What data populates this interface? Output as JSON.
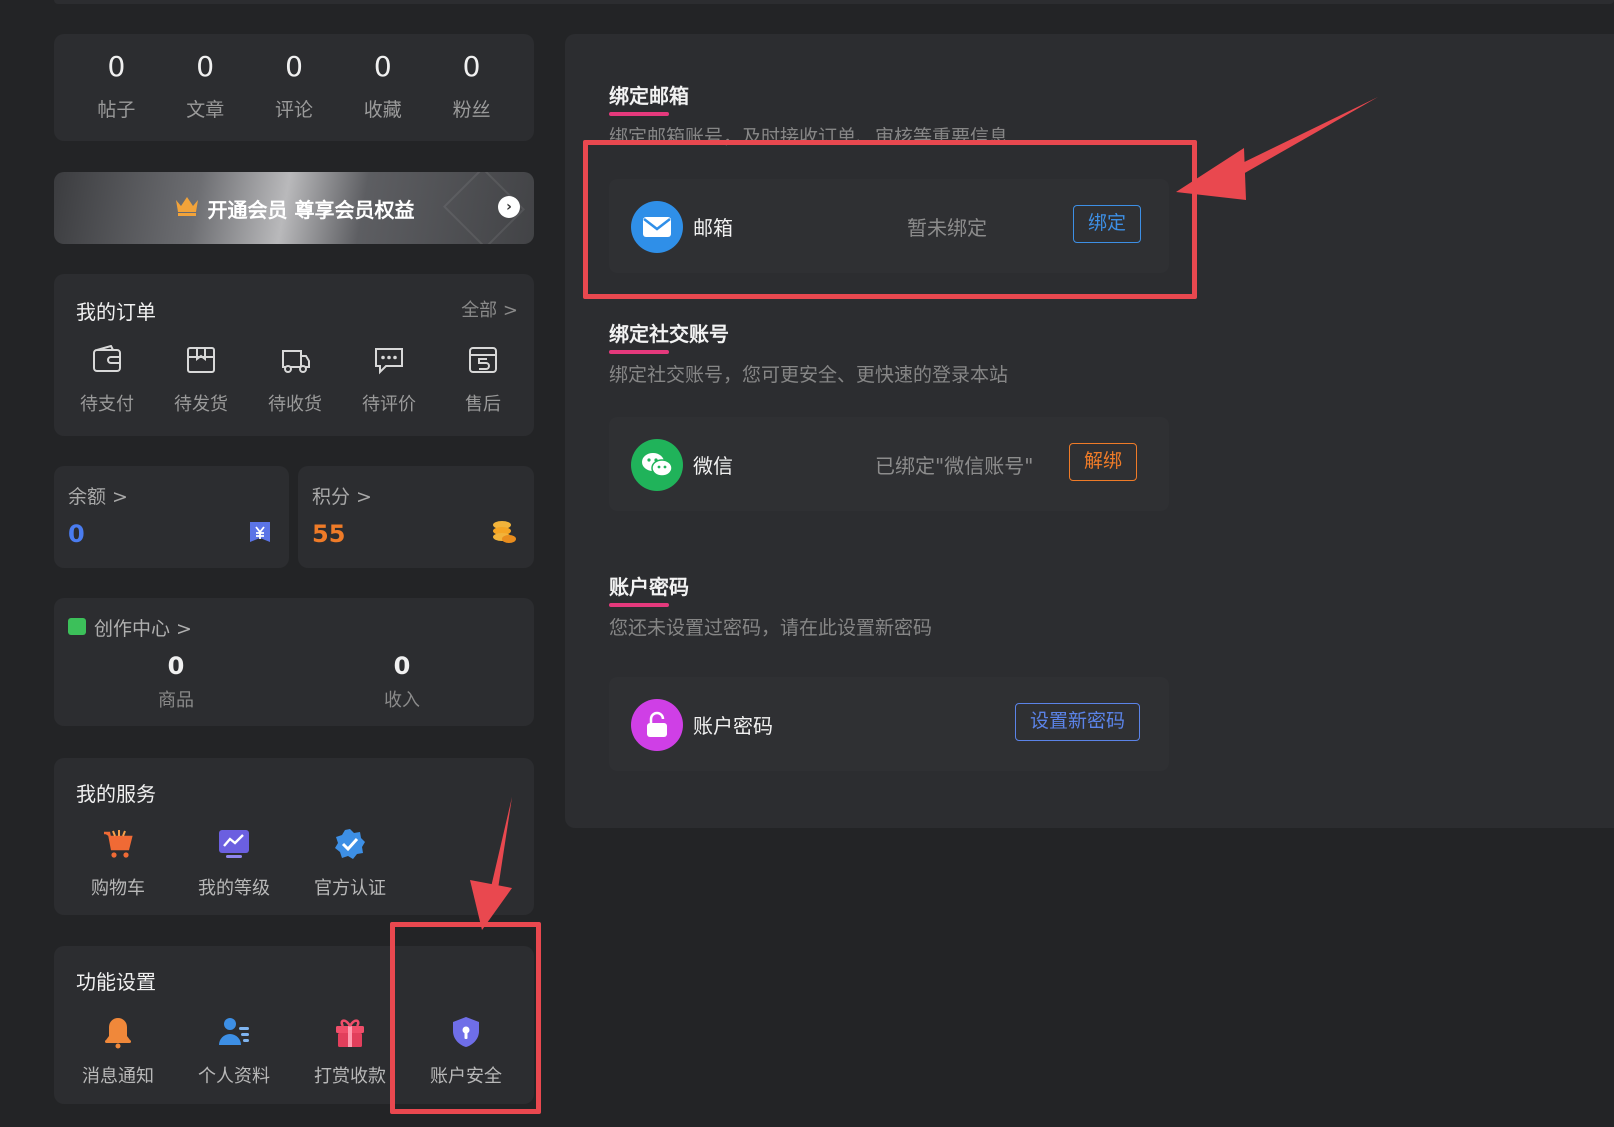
{
  "stats": [
    {
      "value": "0",
      "label": "帖子"
    },
    {
      "value": "0",
      "label": "文章"
    },
    {
      "value": "0",
      "label": "评论"
    },
    {
      "value": "0",
      "label": "收藏"
    },
    {
      "value": "0",
      "label": "粉丝"
    }
  ],
  "vip": {
    "text": "开通会员 尊享会员权益",
    "icon": "crown-icon"
  },
  "orders": {
    "title": "我的订单",
    "more": "全部 >",
    "items": [
      {
        "label": "待支付",
        "icon": "wallet-icon"
      },
      {
        "label": "待发货",
        "icon": "package-icon"
      },
      {
        "label": "待收货",
        "icon": "truck-icon"
      },
      {
        "label": "待评价",
        "icon": "comment-icon"
      },
      {
        "label": "售后",
        "icon": "refund-icon"
      }
    ]
  },
  "balance": {
    "title": "余额 >",
    "value": "0",
    "icon": "yuan-icon"
  },
  "points": {
    "title": "积分 >",
    "value": "55",
    "icon": "coins-icon"
  },
  "create_center": {
    "title": "创作中心 >",
    "items": [
      {
        "value": "0",
        "label": "商品"
      },
      {
        "value": "0",
        "label": "收入"
      }
    ]
  },
  "services": {
    "title": "我的服务",
    "items": [
      {
        "label": "购物车",
        "icon": "cart-icon"
      },
      {
        "label": "我的等级",
        "icon": "level-icon"
      },
      {
        "label": "官方认证",
        "icon": "verified-icon"
      }
    ]
  },
  "settings": {
    "title": "功能设置",
    "items": [
      {
        "label": "消息通知",
        "icon": "bell-icon"
      },
      {
        "label": "个人资料",
        "icon": "profile-icon"
      },
      {
        "label": "打赏收款",
        "icon": "gift-icon"
      },
      {
        "label": "账户安全",
        "icon": "shield-icon"
      }
    ]
  },
  "security": {
    "email_section": {
      "title": "绑定邮箱",
      "desc": "绑定邮箱账号，及时接收订单、审核等重要信息",
      "name": "邮箱",
      "status": "暂未绑定",
      "button": "绑定"
    },
    "social_section": {
      "title": "绑定社交账号",
      "desc": "绑定社交账号，您可更安全、更快速的登录本站",
      "name": "微信",
      "status": "已绑定\"微信账号\"",
      "button": "解绑"
    },
    "password_section": {
      "title": "账户密码",
      "desc": "您还未设置过密码，请在此设置新密码",
      "name": "账户密码",
      "button": "设置新密码"
    }
  },
  "colors": {
    "accent_pink": "#e5397c",
    "annotation_red": "#e9484f",
    "points_orange": "#ef7b28",
    "balance_blue": "#4a7cf0"
  }
}
